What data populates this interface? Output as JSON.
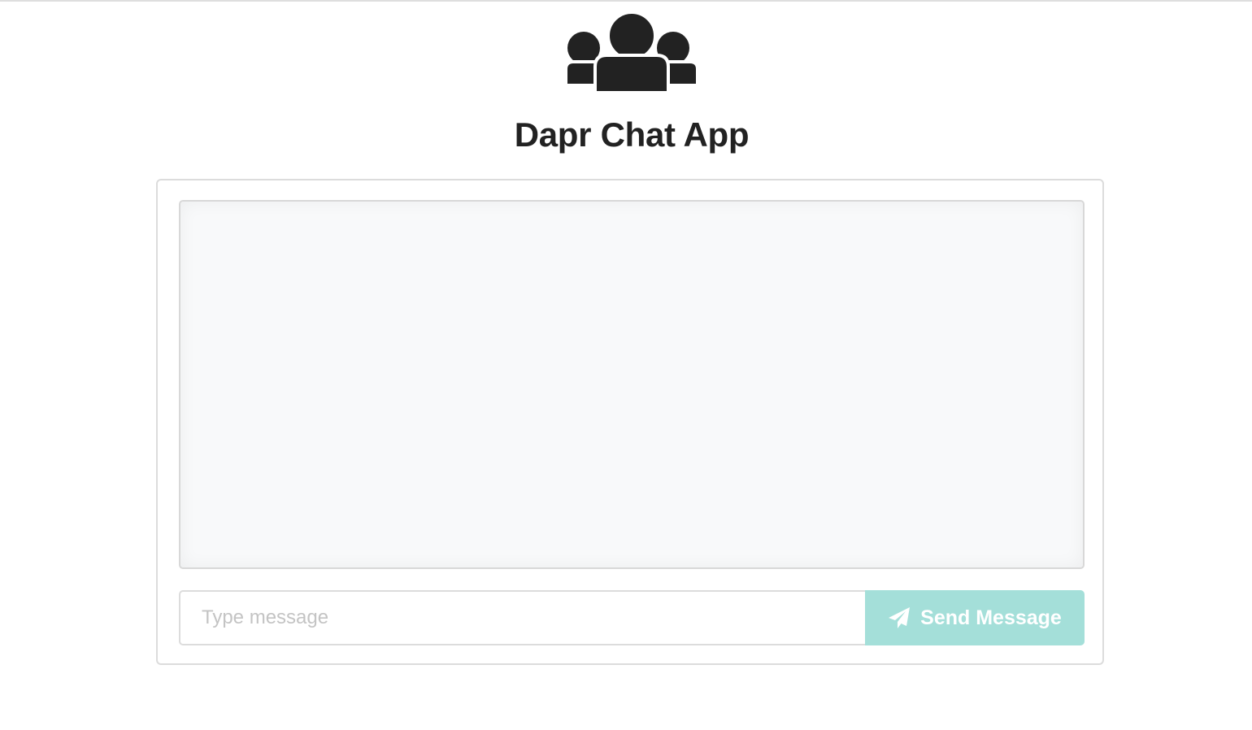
{
  "app": {
    "title": "Dapr Chat App",
    "header_icon": "users-icon"
  },
  "chat": {
    "messages": []
  },
  "composer": {
    "input_value": "",
    "input_placeholder": "Type message",
    "send_label": "Send Message",
    "send_icon": "paper-plane-icon",
    "send_color": "#a4dfd9"
  }
}
